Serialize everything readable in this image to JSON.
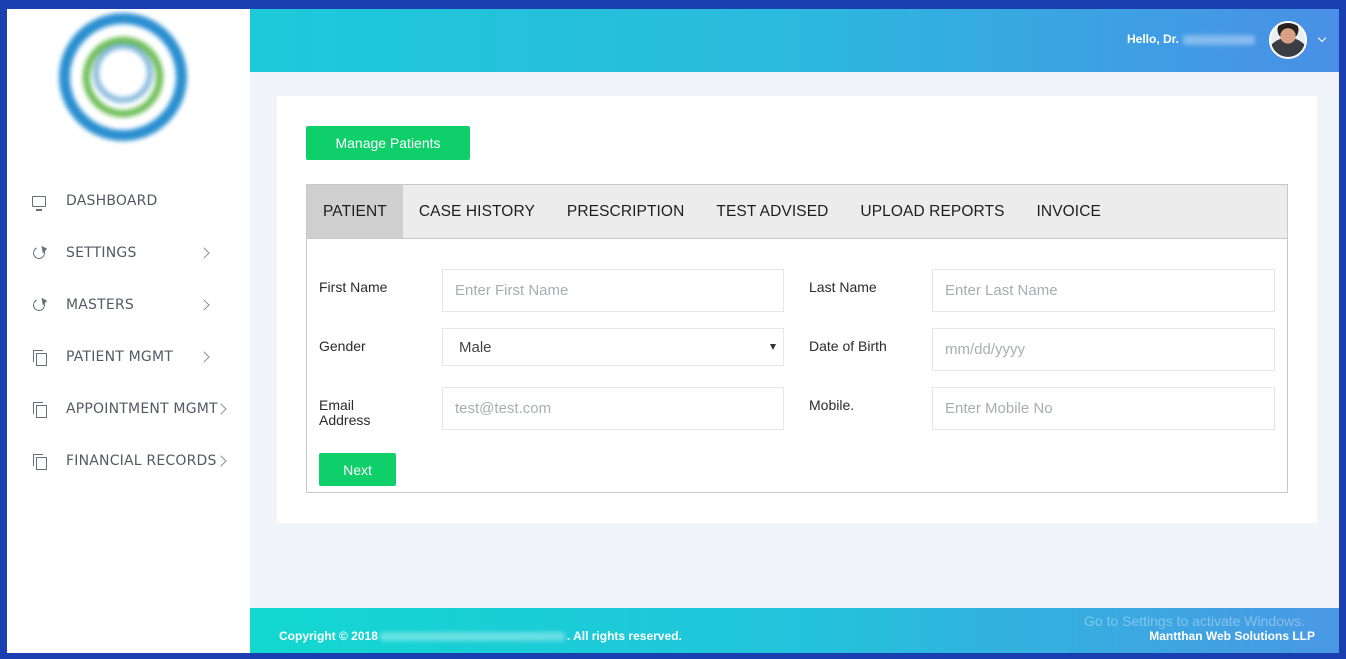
{
  "sidebar": {
    "items": [
      {
        "label": "DASHBOARD",
        "icon": "monitor-icon"
      },
      {
        "label": "SETTINGS",
        "icon": "refresh-icon"
      },
      {
        "label": "MASTERS",
        "icon": "refresh-icon"
      },
      {
        "label": "PATIENT MGMT",
        "icon": "copy-icon"
      },
      {
        "label": "APPOINTMENT MGMT",
        "icon": "copy-icon"
      },
      {
        "label": "FINANCIAL RECORDS",
        "icon": "copy-icon"
      }
    ]
  },
  "header": {
    "greeting": "Hello, Dr."
  },
  "main": {
    "manage_button": "Manage Patients",
    "tabs": [
      {
        "label": "PATIENT",
        "active": true
      },
      {
        "label": "CASE HISTORY"
      },
      {
        "label": "PRESCRIPTION"
      },
      {
        "label": "TEST ADVISED"
      },
      {
        "label": "UPLOAD REPORTS"
      },
      {
        "label": "INVOICE"
      }
    ],
    "form": {
      "first_name": {
        "label": "First Name",
        "placeholder": "Enter First Name"
      },
      "last_name": {
        "label": "Last Name",
        "placeholder": "Enter Last Name"
      },
      "gender": {
        "label": "Gender",
        "value": "Male"
      },
      "dob": {
        "label": "Date of Birth",
        "placeholder": "mm/dd/yyyy"
      },
      "email": {
        "label_line1": "Email",
        "label_line2": "Address",
        "placeholder": "test@test.com"
      },
      "mobile": {
        "label": "Mobile.",
        "placeholder": "Enter Mobile No"
      },
      "next_button": "Next"
    }
  },
  "footer": {
    "copyright_prefix": "Copyright © 2018",
    "copyright_suffix": ". All rights reserved.",
    "credit": "Mantthan Web Solutions LLP",
    "watermark": "Go to Settings to activate Windows."
  },
  "colors": {
    "accent_green": "#0fcf6a",
    "header_start": "#1dcad9",
    "header_end": "#4a8fe6"
  }
}
